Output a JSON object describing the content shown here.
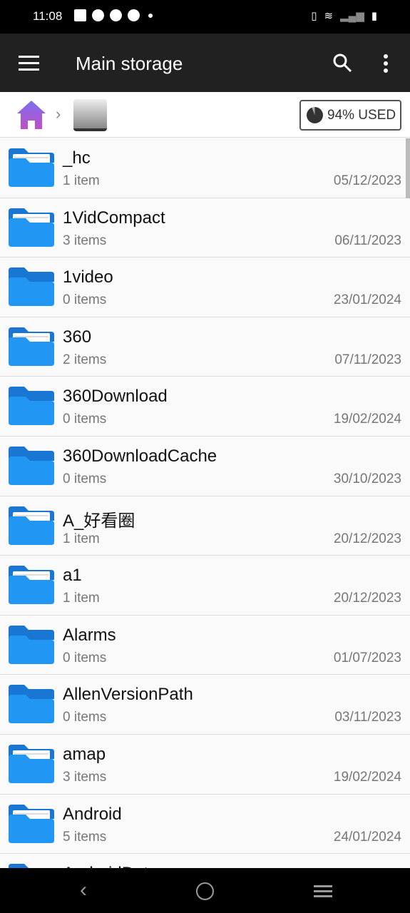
{
  "status_bar": {
    "time": "11:08"
  },
  "toolbar": {
    "title": "Main storage",
    "icons": [
      "menu-icon",
      "search-icon",
      "more-vert-icon"
    ]
  },
  "breadcrumb": {
    "items": [
      "home",
      "main-storage"
    ],
    "storage_used": "94% USED",
    "storage_used_percent": 94
  },
  "colors": {
    "folder": "#2196f3",
    "folder_dark": "#1976d2",
    "home_top": "#7b6ff0",
    "home_bottom": "#c04fc8"
  },
  "files": [
    {
      "name": "_hc",
      "count": "1 item",
      "date": "05/12/2023",
      "empty": false
    },
    {
      "name": "1VidCompact",
      "count": "3 items",
      "date": "06/11/2023",
      "empty": false
    },
    {
      "name": "1video",
      "count": "0 items",
      "date": "23/01/2024",
      "empty": true
    },
    {
      "name": "360",
      "count": "2 items",
      "date": "07/11/2023",
      "empty": false
    },
    {
      "name": "360Download",
      "count": "0 items",
      "date": "19/02/2024",
      "empty": true
    },
    {
      "name": "360DownloadCache",
      "count": "0 items",
      "date": "30/10/2023",
      "empty": true
    },
    {
      "name": "A_好看圈",
      "count": "1 item",
      "date": "20/12/2023",
      "empty": false
    },
    {
      "name": "a1",
      "count": "1 item",
      "date": "20/12/2023",
      "empty": false
    },
    {
      "name": "Alarms",
      "count": "0 items",
      "date": "01/07/2023",
      "empty": true
    },
    {
      "name": "AllenVersionPath",
      "count": "0 items",
      "date": "03/11/2023",
      "empty": true
    },
    {
      "name": "amap",
      "count": "3 items",
      "date": "19/02/2024",
      "empty": false
    },
    {
      "name": "Android",
      "count": "5 items",
      "date": "24/01/2024",
      "empty": false
    },
    {
      "name": "AndroidDat",
      "count": "",
      "date": "",
      "empty": true
    }
  ]
}
